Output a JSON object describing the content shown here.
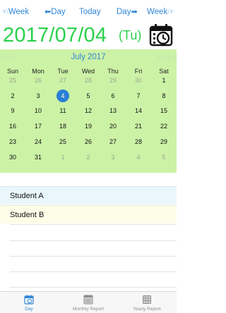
{
  "nav": {
    "prev_week": "Week",
    "prev_day": "Day",
    "today": "Today",
    "next_day": "Day",
    "next_week": "Week",
    "color": "#2f86d6"
  },
  "header": {
    "date": "2017/07/04",
    "weekday": "(Tu)",
    "color": "#2ad14a",
    "calendar_icon": "calendar-clock-icon"
  },
  "calendar": {
    "prev_year_label": "2017",
    "month_title": "July 2017",
    "next_month_label": "Augus",
    "background": "#ccf2a6",
    "selected_color": "#2a7fd4",
    "weekdays": [
      "Sun",
      "Mon",
      "Tue",
      "Wed",
      "Thu",
      "Fri",
      "Sat"
    ],
    "weeks": [
      [
        {
          "d": "25",
          "o": true
        },
        {
          "d": "26",
          "o": true
        },
        {
          "d": "27",
          "o": true
        },
        {
          "d": "28",
          "o": true
        },
        {
          "d": "29",
          "o": true
        },
        {
          "d": "30",
          "o": true
        },
        {
          "d": "1",
          "o": false
        }
      ],
      [
        {
          "d": "2",
          "o": false
        },
        {
          "d": "3",
          "o": false
        },
        {
          "d": "4",
          "o": false,
          "s": true
        },
        {
          "d": "5",
          "o": false
        },
        {
          "d": "6",
          "o": false
        },
        {
          "d": "7",
          "o": false
        },
        {
          "d": "8",
          "o": false
        }
      ],
      [
        {
          "d": "9",
          "o": false
        },
        {
          "d": "10",
          "o": false
        },
        {
          "d": "11",
          "o": false
        },
        {
          "d": "12",
          "o": false
        },
        {
          "d": "13",
          "o": false
        },
        {
          "d": "14",
          "o": false
        },
        {
          "d": "15",
          "o": false
        }
      ],
      [
        {
          "d": "16",
          "o": false
        },
        {
          "d": "17",
          "o": false
        },
        {
          "d": "18",
          "o": false
        },
        {
          "d": "19",
          "o": false
        },
        {
          "d": "20",
          "o": false
        },
        {
          "d": "21",
          "o": false
        },
        {
          "d": "22",
          "o": false
        }
      ],
      [
        {
          "d": "23",
          "o": false
        },
        {
          "d": "24",
          "o": false
        },
        {
          "d": "25",
          "o": false
        },
        {
          "d": "26",
          "o": false
        },
        {
          "d": "27",
          "o": false
        },
        {
          "d": "28",
          "o": false
        },
        {
          "d": "29",
          "o": false
        }
      ],
      [
        {
          "d": "30",
          "o": false
        },
        {
          "d": "31",
          "o": false
        },
        {
          "d": "1",
          "o": true
        },
        {
          "d": "2",
          "o": true
        },
        {
          "d": "3",
          "o": true
        },
        {
          "d": "4",
          "o": true
        },
        {
          "d": "5",
          "o": true
        }
      ]
    ]
  },
  "students": [
    {
      "name": "Student A",
      "color": "#e9f7fd"
    },
    {
      "name": "Student B",
      "color": "#fdfde8"
    }
  ],
  "tabs": [
    {
      "label": "Day",
      "icon": "calendar-day-icon",
      "active": true
    },
    {
      "label": "Monthly Report",
      "icon": "monthly-report-icon",
      "active": false
    },
    {
      "label": "Yearly Report",
      "icon": "yearly-report-icon",
      "active": false
    }
  ]
}
